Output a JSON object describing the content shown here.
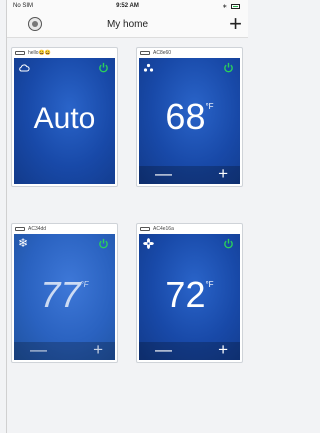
{
  "status_bar": {
    "carrier": "No SIM",
    "time": "9:52 AM",
    "battery_label": ""
  },
  "nav": {
    "title": "My home",
    "add_label": "+"
  },
  "devices": [
    {
      "name": "hello😀😀",
      "mode_icon": "cloud-icon",
      "display": "Auto",
      "unit": "",
      "power_color": "#2bd05a"
    },
    {
      "name": "AC8e60",
      "mode_icon": "drops-icon",
      "display": "68",
      "unit": "°F",
      "power_color": "#2bd05a"
    },
    {
      "name": "AC34dd",
      "mode_icon": "snowflake-icon",
      "display": "77",
      "unit": "°F",
      "power_color": "#2bd05a"
    },
    {
      "name": "AC4e16a",
      "mode_icon": "fan-icon",
      "display": "72",
      "unit": "°F",
      "power_color": "#2bd05a"
    }
  ],
  "controls": {
    "minus": "—",
    "plus": "+"
  }
}
